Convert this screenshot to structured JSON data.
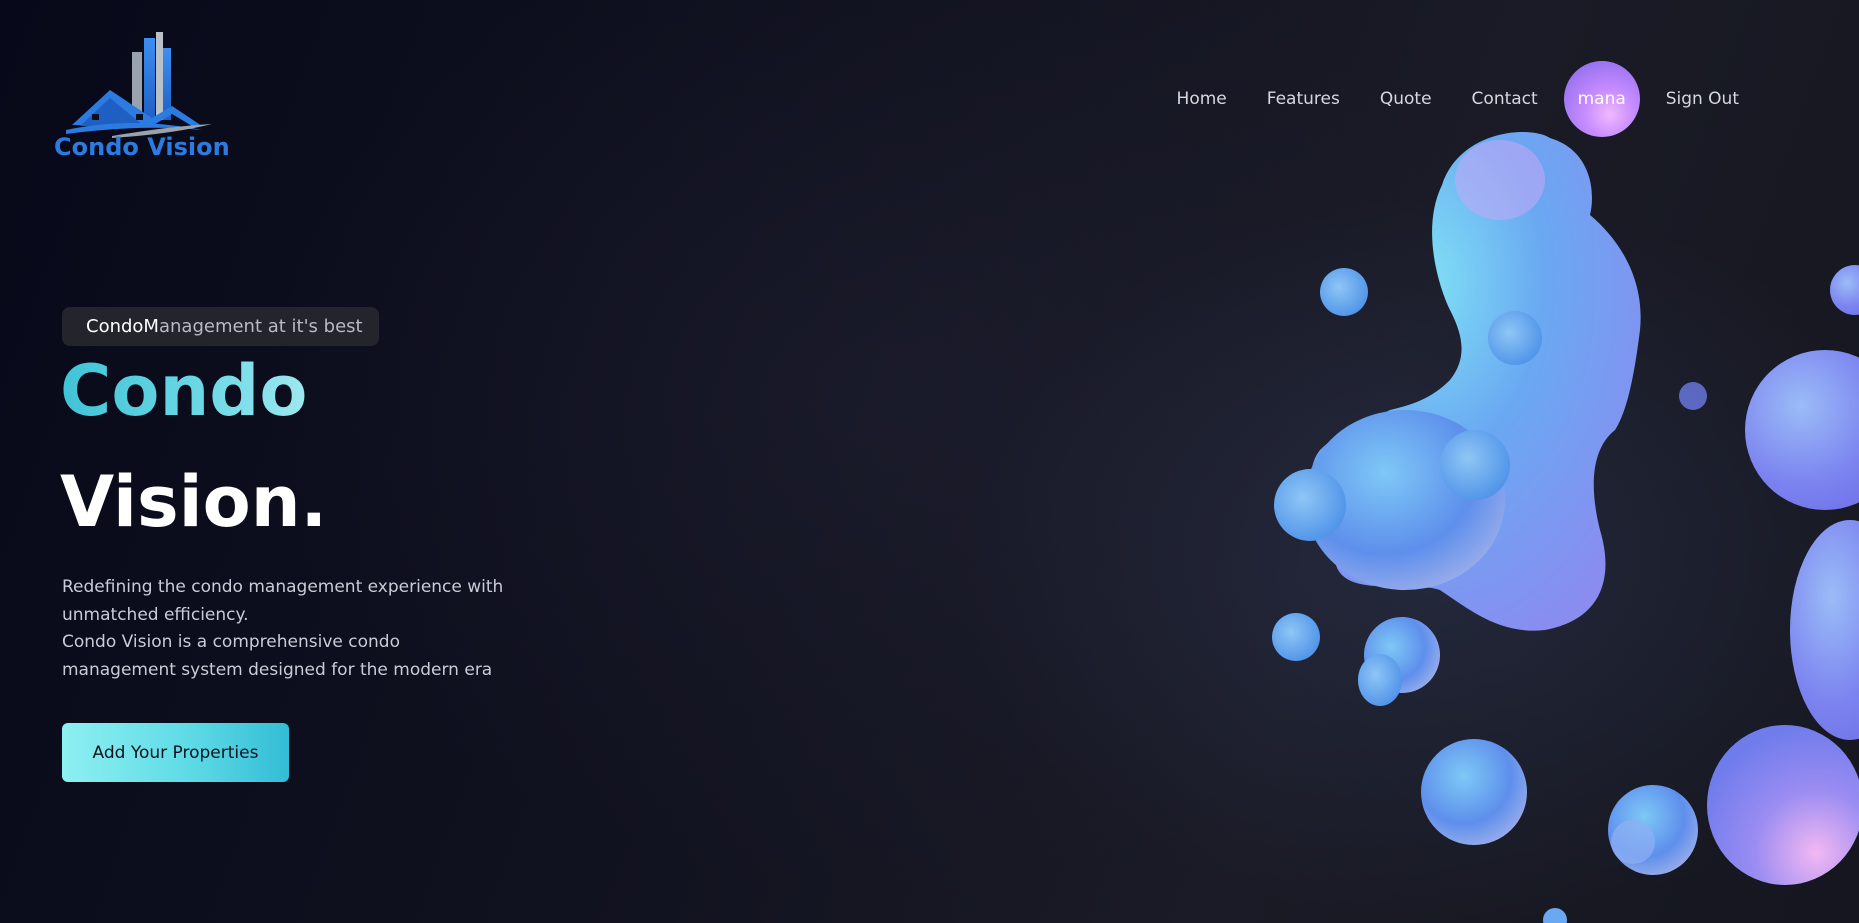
{
  "brand": {
    "name": "Condo Vision",
    "logo_icon": "building-house-icon",
    "color": "#2b7be0"
  },
  "nav": {
    "items": [
      {
        "label": "Home"
      },
      {
        "label": "Features"
      },
      {
        "label": "Quote"
      },
      {
        "label": "Contact"
      }
    ],
    "user": "mana",
    "sign_out": "Sign Out"
  },
  "hero": {
    "tagline_highlight": "CondoM",
    "tagline_rest": "anagement at it's best",
    "title_line1": "Condo",
    "title_line2": "Vision.",
    "description_lines": [
      "Redefining the condo management experience with",
      "unmatched efficiency.",
      "Condo Vision is a comprehensive condo",
      "management system designed for the modern era"
    ],
    "cta_label": "Add Your Properties"
  },
  "colors": {
    "accent": "#5fdbe6",
    "background": "#0d0f1a",
    "user_badge": "#c78cff"
  }
}
